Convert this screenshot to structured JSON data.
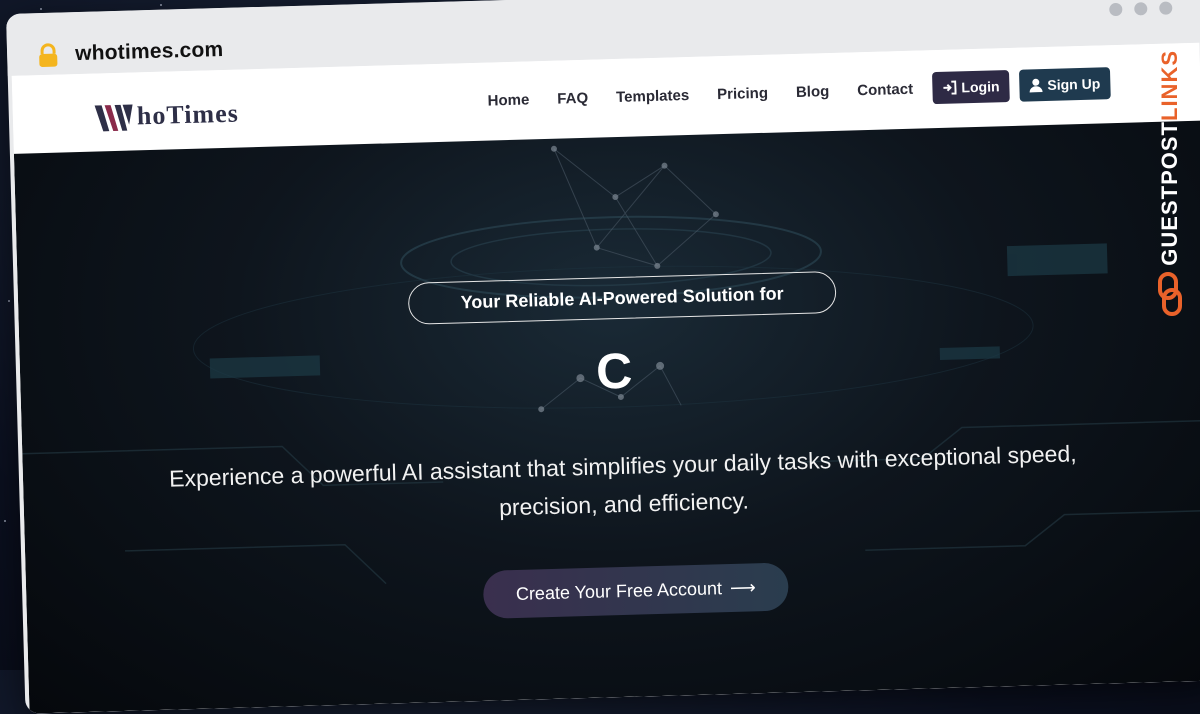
{
  "browser": {
    "url": "whotimes.com"
  },
  "nav": {
    "logo_text": "hoTimes",
    "menu": [
      "Home",
      "FAQ",
      "Templates",
      "Pricing",
      "Blog",
      "Contact"
    ],
    "login_label": "Login",
    "signup_label": "Sign Up"
  },
  "hero": {
    "tagline": "Your Reliable AI-Powered Solution for",
    "typed_text": "C",
    "subtitle": "Experience a powerful AI assistant that simplifies your daily tasks with exceptional speed, precision, and efficiency.",
    "cta_label": "Create Your Free Account",
    "cta_arrow": "⟶"
  },
  "watermark": {
    "text_main": "GUESTPOST",
    "text_accent": "LINKS"
  },
  "colors": {
    "login_bg": "#2e2a45",
    "signup_bg": "#1f3a4f",
    "watermark_accent": "#e9622a"
  }
}
